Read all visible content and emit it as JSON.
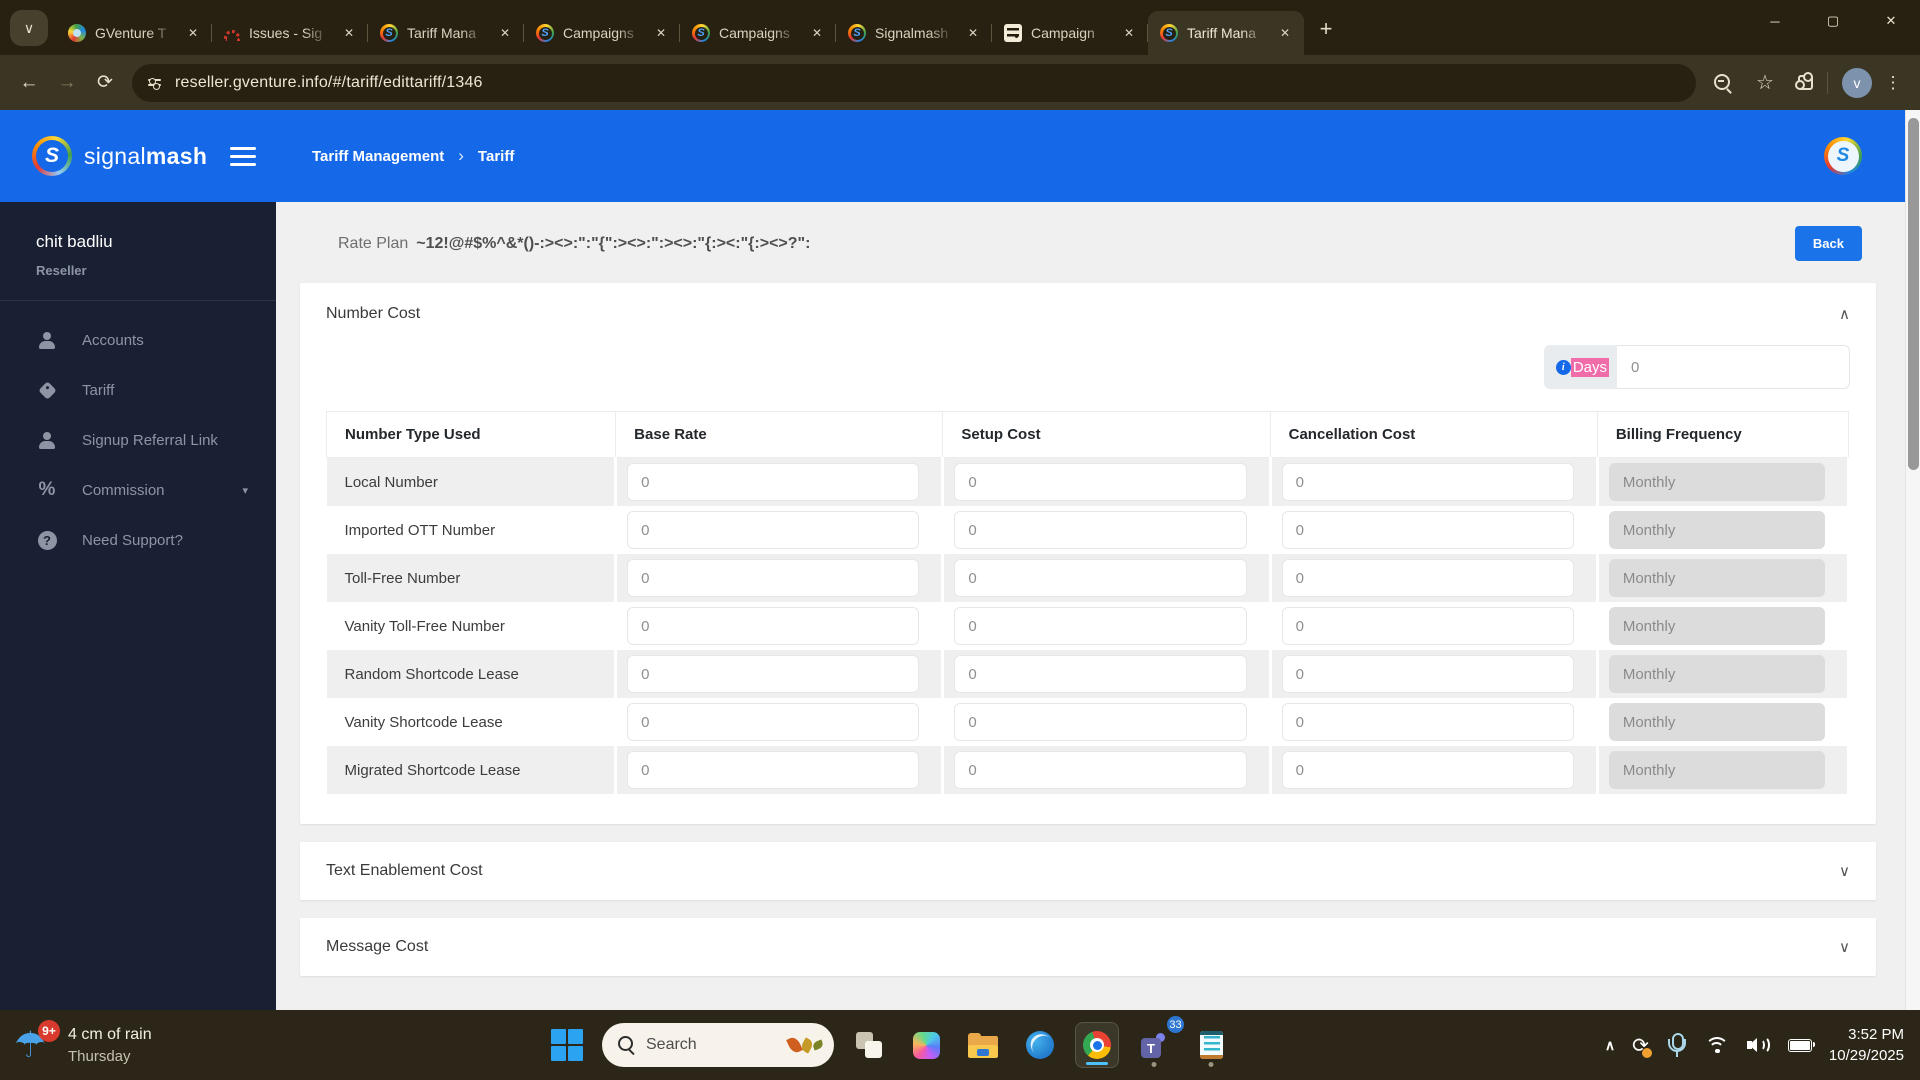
{
  "browser": {
    "tabs": [
      {
        "title": "GVenture T",
        "icon": "gventure",
        "active": false
      },
      {
        "title": "Issues - Sig",
        "icon": "redmine",
        "active": false
      },
      {
        "title": "Tariff Mana",
        "icon": "signalmash",
        "active": false
      },
      {
        "title": "Campaigns",
        "icon": "signalmash",
        "active": false
      },
      {
        "title": "Campaigns",
        "icon": "signalmash",
        "active": false
      },
      {
        "title": "Signalmash",
        "icon": "signalmash",
        "active": false
      },
      {
        "title": "Campaign",
        "icon": "doc",
        "active": false
      },
      {
        "title": "Tariff Mana",
        "icon": "signalmash",
        "active": true
      }
    ],
    "toolbar": {
      "url": "reseller.gventure.info/#/tariff/edittariff/1346",
      "profile_initial": "v"
    },
    "icons": {
      "tab_search": "∨",
      "tab_close": "✕",
      "new_tab": "+",
      "minimize": "─",
      "maximize": "▢",
      "close": "✕",
      "back": "←",
      "forward": "→",
      "reload": "⟳",
      "star": "☆",
      "kebab": "⋮"
    }
  },
  "sidebar": {
    "brand_light": "signal",
    "brand_bold": "mash",
    "user_name": "chit badliu",
    "user_role": "Reseller",
    "items": [
      {
        "label": "Accounts",
        "icon": "user",
        "caret": false
      },
      {
        "label": "Tariff",
        "icon": "tag",
        "caret": false
      },
      {
        "label": "Signup Referral Link",
        "icon": "user",
        "caret": false
      },
      {
        "label": "Commission",
        "icon": "percent",
        "caret": true
      },
      {
        "label": "Need Support?",
        "icon": "question",
        "caret": false
      }
    ],
    "caret_icon": "▾"
  },
  "header": {
    "breadcrumb_primary": "Tariff Management",
    "breadcrumb_separator": "›",
    "breadcrumb_current": "Tariff"
  },
  "main": {
    "rate_plan_label": "Rate Plan",
    "rate_plan_value": "~12!@#$%^&*()-:><>:\":\"{\":><>:\":><>:\"{:><:\"{:><>?\":",
    "back_button": "Back",
    "number_cost": {
      "title": "Number Cost",
      "collapse_icon": "∧",
      "info_icon": "i",
      "days_label": "Days",
      "days_value": "0",
      "headers": [
        "Number Type Used",
        "Base Rate",
        "Setup Cost",
        "Cancellation Cost",
        "Billing Frequency"
      ],
      "rows": [
        {
          "label": "Local Number",
          "base_rate": "0",
          "setup_cost": "0",
          "cancellation_cost": "0",
          "billing_frequency": "Monthly"
        },
        {
          "label": "Imported OTT Number",
          "base_rate": "0",
          "setup_cost": "0",
          "cancellation_cost": "0",
          "billing_frequency": "Monthly"
        },
        {
          "label": "Toll-Free Number",
          "base_rate": "0",
          "setup_cost": "0",
          "cancellation_cost": "0",
          "billing_frequency": "Monthly"
        },
        {
          "label": "Vanity Toll-Free Number",
          "base_rate": "0",
          "setup_cost": "0",
          "cancellation_cost": "0",
          "billing_frequency": "Monthly"
        },
        {
          "label": "Random Shortcode Lease",
          "base_rate": "0",
          "setup_cost": "0",
          "cancellation_cost": "0",
          "billing_frequency": "Monthly"
        },
        {
          "label": "Vanity Shortcode Lease",
          "base_rate": "0",
          "setup_cost": "0",
          "cancellation_cost": "0",
          "billing_frequency": "Monthly"
        },
        {
          "label": "Migrated Shortcode Lease",
          "base_rate": "0",
          "setup_cost": "0",
          "cancellation_cost": "0",
          "billing_frequency": "Monthly"
        }
      ]
    },
    "text_enablement": {
      "title": "Text Enablement Cost",
      "expand_icon": "∨"
    },
    "message_cost": {
      "title": "Message Cost",
      "expand_icon": "∨"
    }
  },
  "taskbar": {
    "weather_badge": "9+",
    "weather_line1": "4 cm of rain",
    "weather_line2": "Thursday",
    "search_placeholder": "Search",
    "teams_badge": "33",
    "teams_letter": "T",
    "tray_chevron": "∧",
    "sync_icon": "⟳",
    "time": "3:52 PM",
    "date": "10/29/2025"
  },
  "colors": {
    "accent_blue": "#1568e8",
    "sidebar_navy": "#1a2033",
    "chrome_dark": "#282112",
    "chrome_frame": "#3b3523",
    "taskbar": "#2b2617",
    "highlight_pink": "#f06daa",
    "back_button": "#1a73e8"
  }
}
